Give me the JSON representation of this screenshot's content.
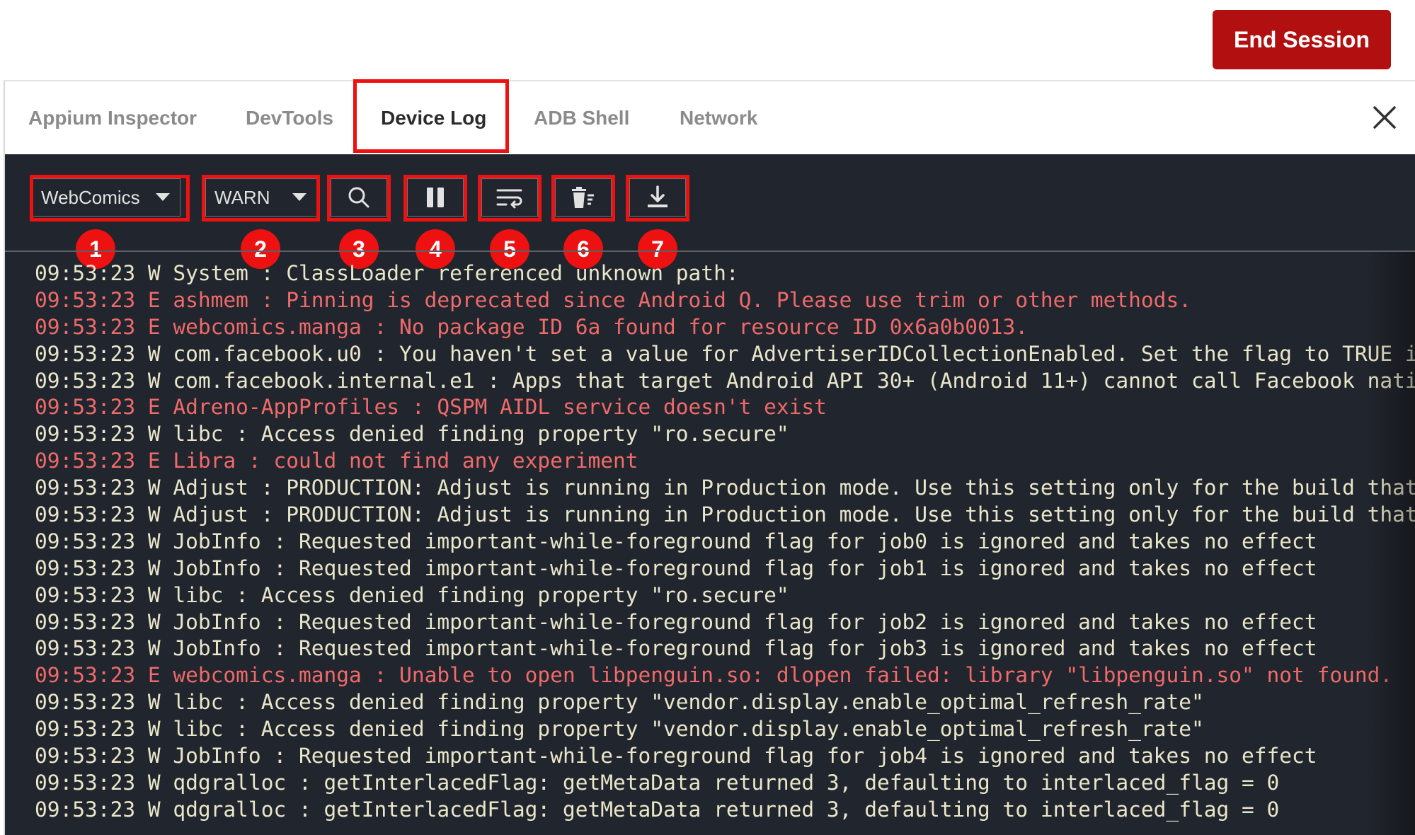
{
  "header": {
    "end_session_label": "End Session"
  },
  "tabs": [
    {
      "label": "Appium Inspector",
      "active": false
    },
    {
      "label": "DevTools",
      "active": false
    },
    {
      "label": "Device Log",
      "active": true
    },
    {
      "label": "ADB Shell",
      "active": false
    },
    {
      "label": "Network",
      "active": false
    }
  ],
  "toolbar": {
    "app_select_value": "WebComics",
    "level_select_value": "WARN",
    "buttons": [
      "search-icon",
      "pause-icon",
      "wrap-lines-icon",
      "clear-log-icon",
      "download-icon"
    ]
  },
  "markers": [
    "1",
    "2",
    "3",
    "4",
    "5",
    "6",
    "7"
  ],
  "colors": {
    "end_session_bg": "#b10f10",
    "highlight": "#ee1111",
    "log_bg": "#21252d",
    "warn_text": "#e9e6c9",
    "error_text": "#f06a6a"
  },
  "log": [
    {
      "level": "W",
      "text": "09:53:23 W System : ClassLoader referenced unknown path:"
    },
    {
      "level": "E",
      "text": "09:53:23 E ashmem : Pinning is deprecated since Android Q. Please use trim or other methods."
    },
    {
      "level": "E",
      "text": "09:53:23 E webcomics.manga : No package ID 6a found for resource ID 0x6a0b0013."
    },
    {
      "level": "W",
      "text": "09:53:23 W com.facebook.u0 : You haven't set a value for AdvertiserIDCollectionEnabled. Set the flag to TRUE i"
    },
    {
      "level": "W",
      "text": "09:53:23 W com.facebook.internal.e1 : Apps that target Android API 30+ (Android 11+) cannot call Facebook nativ"
    },
    {
      "level": "E",
      "text": "09:53:23 E Adreno-AppProfiles : QSPM AIDL service doesn't exist"
    },
    {
      "level": "W",
      "text": "09:53:23 W libc : Access denied finding property \"ro.secure\""
    },
    {
      "level": "E",
      "text": "09:53:23 E Libra : could not find any experiment"
    },
    {
      "level": "W",
      "text": "09:53:23 W Adjust : PRODUCTION: Adjust is running in Production mode. Use this setting only for the build that"
    },
    {
      "level": "W",
      "text": "09:53:23 W Adjust : PRODUCTION: Adjust is running in Production mode. Use this setting only for the build that"
    },
    {
      "level": "W",
      "text": "09:53:23 W JobInfo : Requested important-while-foreground flag for job0 is ignored and takes no effect"
    },
    {
      "level": "W",
      "text": "09:53:23 W JobInfo : Requested important-while-foreground flag for job1 is ignored and takes no effect"
    },
    {
      "level": "W",
      "text": "09:53:23 W libc : Access denied finding property \"ro.secure\""
    },
    {
      "level": "W",
      "text": "09:53:23 W JobInfo : Requested important-while-foreground flag for job2 is ignored and takes no effect"
    },
    {
      "level": "W",
      "text": "09:53:23 W JobInfo : Requested important-while-foreground flag for job3 is ignored and takes no effect"
    },
    {
      "level": "E",
      "text": "09:53:23 E webcomics.manga : Unable to open libpenguin.so: dlopen failed: library \"libpenguin.so\" not found."
    },
    {
      "level": "W",
      "text": "09:53:23 W libc : Access denied finding property \"vendor.display.enable_optimal_refresh_rate\""
    },
    {
      "level": "W",
      "text": "09:53:23 W libc : Access denied finding property \"vendor.display.enable_optimal_refresh_rate\""
    },
    {
      "level": "W",
      "text": "09:53:23 W JobInfo : Requested important-while-foreground flag for job4 is ignored and takes no effect"
    },
    {
      "level": "W",
      "text": "09:53:23 W qdgralloc : getInterlacedFlag: getMetaData returned 3, defaulting to interlaced_flag = 0"
    },
    {
      "level": "W",
      "text": "09:53:23 W qdgralloc : getInterlacedFlag: getMetaData returned 3, defaulting to interlaced_flag = 0"
    }
  ]
}
